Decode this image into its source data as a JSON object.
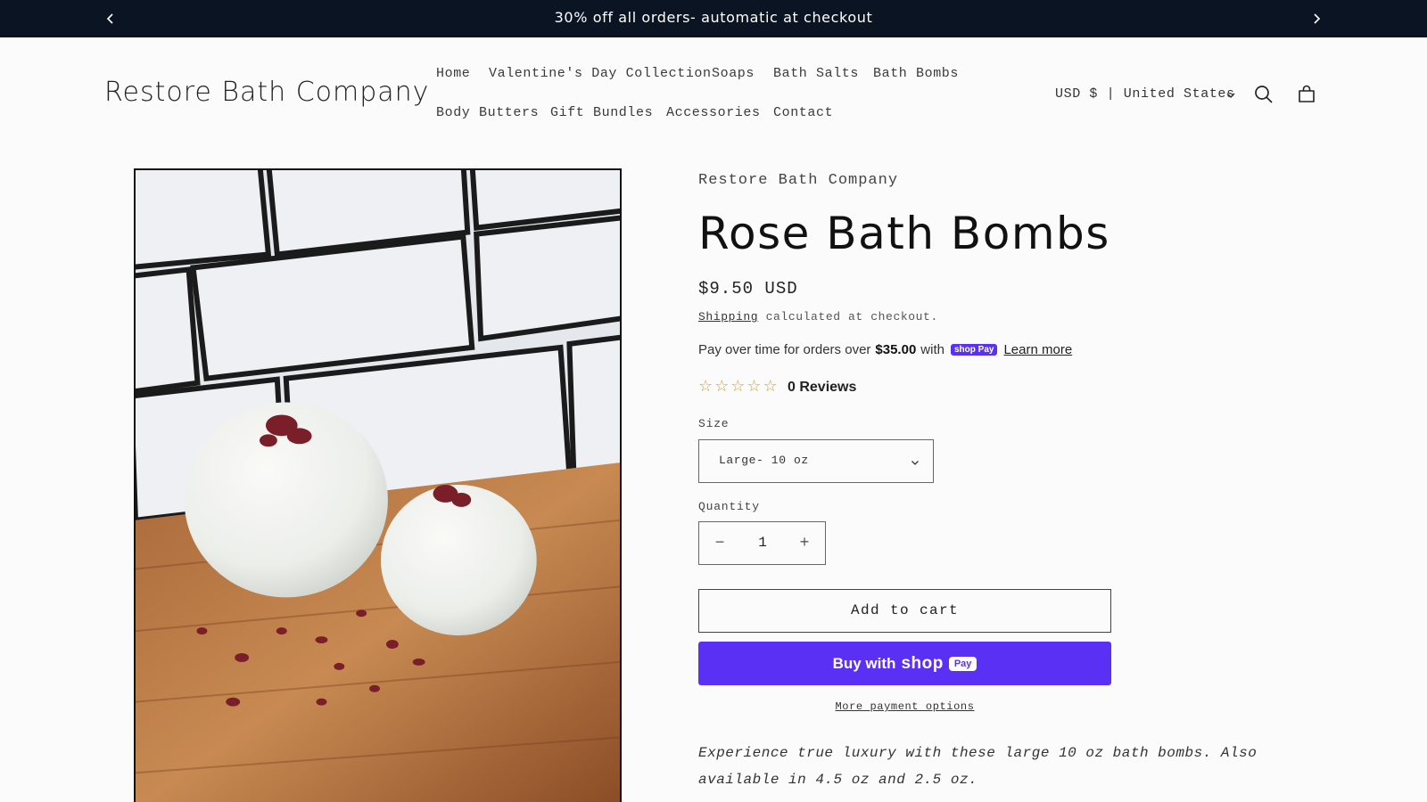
{
  "announcement": {
    "text": "30% off all orders- automatic at checkout",
    "prev_icon": "chevron-left-icon",
    "next_icon": "chevron-right-icon"
  },
  "header": {
    "logo": "Restore Bath Company",
    "nav": [
      {
        "label": "Home"
      },
      {
        "label": "Valentine's Day Collection"
      },
      {
        "label": "Soaps"
      },
      {
        "label": "Bath Salts"
      },
      {
        "label": "Bath Bombs"
      },
      {
        "label": "Body Butters"
      },
      {
        "label": "Gift Bundles"
      },
      {
        "label": "Accessories"
      },
      {
        "label": "Contact"
      }
    ],
    "currency": "USD $ | United States",
    "icons": [
      "search-icon",
      "cart-icon"
    ]
  },
  "product": {
    "vendor": "Restore Bath Company",
    "title": "Rose Bath Bombs",
    "price": "$9.50 USD",
    "shipping_link": "Shipping",
    "shipping_text": " calculated at checkout.",
    "installments": {
      "prefix": "Pay over time for orders over",
      "amount": "$35.00",
      "with": "with",
      "badge": "shop Pay",
      "learn_more": "Learn more"
    },
    "rating": {
      "stars_filled": 0,
      "stars_total": 5,
      "reviews_label": "0 Reviews"
    },
    "size": {
      "label": "Size",
      "selected": "Large- 10 oz"
    },
    "quantity": {
      "label": "Quantity",
      "value": "1",
      "minus": "−",
      "plus": "+"
    },
    "add_to_cart": "Add to cart",
    "buy_now": {
      "prefix": "Buy with",
      "brand": "shop",
      "pill": "Pay"
    },
    "more_payment_options": "More payment options",
    "description": "Experience true luxury with these large 10 oz bath bombs. Also available in 4.5 oz and 2.5 oz."
  },
  "colors": {
    "announcement_bg": "#0b1423",
    "shop_pay_purple": "#5a31f4",
    "star_outline": "#c9a54a"
  }
}
